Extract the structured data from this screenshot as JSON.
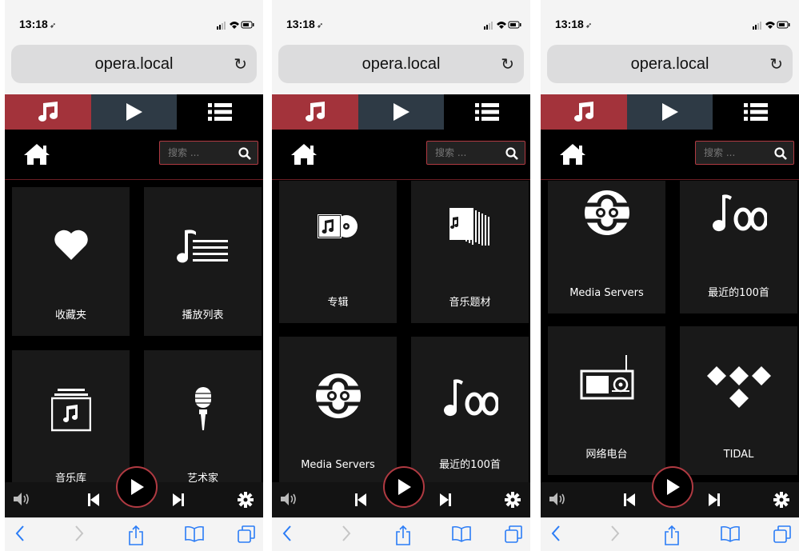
{
  "browser": {
    "time": "13:18",
    "url": "opera.local"
  },
  "search": {
    "placeholder": "搜索 ..."
  },
  "colors": {
    "accent_red": "#a3333b",
    "tab_blue": "#2e3a45",
    "tile_bg": "#191919"
  },
  "tabs": [
    {
      "icon": "music-note-icon"
    },
    {
      "icon": "play-icon"
    },
    {
      "icon": "list-icon"
    }
  ],
  "screens": [
    {
      "tiles": [
        {
          "label": "收藏夹",
          "icon": "heart-icon"
        },
        {
          "label": "播放列表",
          "icon": "playlist-icon"
        },
        {
          "label": "音乐库",
          "icon": "library-icon"
        },
        {
          "label": "艺术家",
          "icon": "microphone-icon"
        }
      ]
    },
    {
      "tiles": [
        {
          "label": "专辑",
          "icon": "album-icon"
        },
        {
          "label": "音乐题材",
          "icon": "genre-icon"
        },
        {
          "label": "Media Servers",
          "icon": "media-server-icon"
        },
        {
          "label": "最近的100首",
          "icon": "recent-100-icon"
        }
      ]
    },
    {
      "tiles": [
        {
          "label": "Media Servers",
          "icon": "media-server-icon"
        },
        {
          "label": "最近的100首",
          "icon": "recent-100-icon"
        },
        {
          "label": "网络电台",
          "icon": "radio-icon"
        },
        {
          "label": "TIDAL",
          "icon": "tidal-icon"
        }
      ]
    }
  ]
}
